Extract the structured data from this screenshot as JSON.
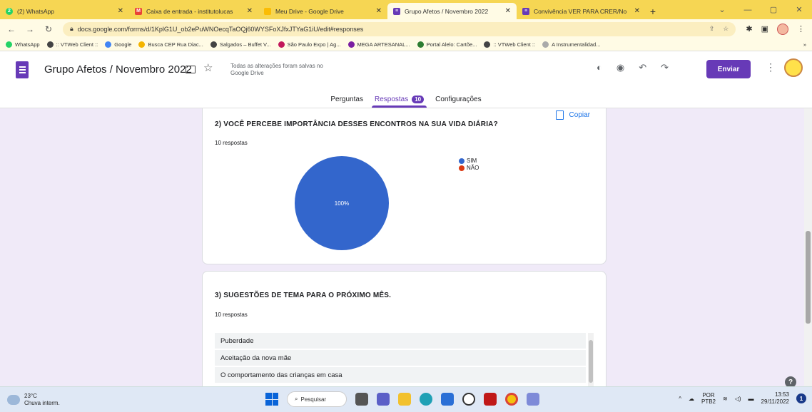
{
  "browser": {
    "tabs": [
      {
        "label": "(2) WhatsApp",
        "icon": "whatsapp-icon",
        "color": "#25d366"
      },
      {
        "label": "Caixa de entrada - institutolucas",
        "icon": "gmail-icon",
        "color": "#ea4335"
      },
      {
        "label": "Meu Drive - Google Drive",
        "icon": "drive-icon",
        "color": "#fbbc04"
      },
      {
        "label": "Grupo Afetos / Novembro 2022",
        "icon": "forms-icon",
        "color": "#673ab7"
      },
      {
        "label": "Convivência VER PARA CRER/No",
        "icon": "forms-icon",
        "color": "#673ab7"
      }
    ],
    "url": "docs.google.com/forms/d/1KplG1U_ob2ePuWNOecqTaOQj60WYSFoXJfxJTYaG1iU/edit#responses",
    "bookmarks": [
      {
        "label": "WhatsApp",
        "color": "#25d366"
      },
      {
        "label": ":: VTWeb Client ::",
        "color": "#444"
      },
      {
        "label": "Google",
        "color": "#4285f4"
      },
      {
        "label": "Busca CEP Rua Diac...",
        "color": "#f4b400"
      },
      {
        "label": "Salgados – Buffet V...",
        "color": "#444"
      },
      {
        "label": "São Paulo Expo | Ag...",
        "color": "#c2185b"
      },
      {
        "label": "MEGA ARTESANAL...",
        "color": "#7b1fa2"
      },
      {
        "label": "Portal Alelo: Cartõe...",
        "color": "#2e7d32"
      },
      {
        "label": ":: VTWeb Client ::",
        "color": "#444"
      },
      {
        "label": "A Instrumentalidad...",
        "color": "#aaa"
      }
    ]
  },
  "form": {
    "title": "Grupo Afetos / Novembro 2022",
    "saved_status": "Todas as alterações foram salvas no Google Drive",
    "send_label": "Enviar",
    "tabs": [
      {
        "label": "Perguntas"
      },
      {
        "label": "Respostas",
        "count": "10"
      },
      {
        "label": "Configurações"
      }
    ]
  },
  "questions": [
    {
      "title": "2) VOCÊ PERCEBE IMPORTÂNCIA DESSES ENCONTROS NA SUA VIDA DIÁRIA?",
      "responses": "10 respostas",
      "copy_label": "Copiar"
    },
    {
      "title": "3) SUGESTÕES DE TEMA PARA O PRÓXIMO MÊS.",
      "responses": "10 respostas",
      "answers": [
        "Puberdade",
        "Aceitação da nova mãe",
        "O comportamento das crianças em casa"
      ]
    }
  ],
  "chart_data": {
    "type": "pie",
    "categories": [
      "SIM",
      "NÃO"
    ],
    "values": [
      100,
      0
    ],
    "labels": [
      "100%",
      ""
    ],
    "colors": [
      "#3366cc",
      "#dc3912"
    ],
    "legend_position": "right"
  },
  "taskbar": {
    "temp": "23°C",
    "weather": "Chuva interm.",
    "search": "Pesquisar",
    "lang1": "POR",
    "lang2": "PTB2",
    "time": "13:53",
    "date": "29/11/2022"
  }
}
